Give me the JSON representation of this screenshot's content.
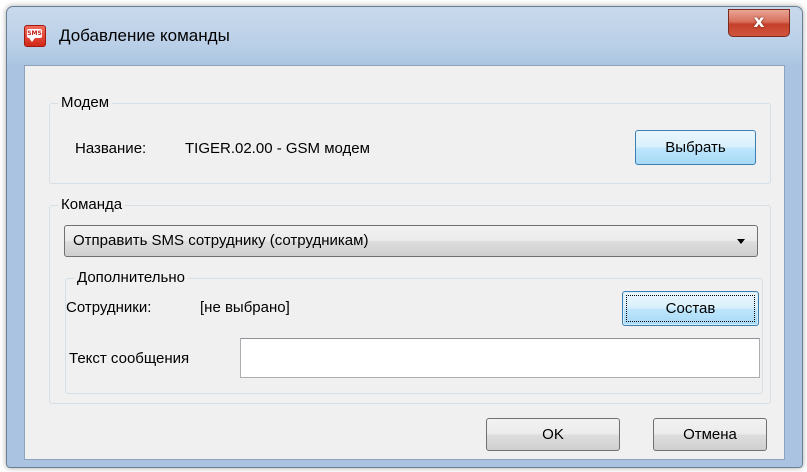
{
  "window": {
    "title": "Добавление команды",
    "app_icon": "sms-icon",
    "close_label": "x"
  },
  "modem_group": {
    "legend": "Модем",
    "name_label": "Название:",
    "name_value": "TIGER.02.00 - GSM модем",
    "select_button": "Выбрать"
  },
  "command_group": {
    "legend": "Команда",
    "selected_command": "Отправить SMS сотруднику (сотрудникам)",
    "dropdown_icon": "chevron-down-icon"
  },
  "additional_group": {
    "legend": "Дополнительно",
    "employees_label": "Сотрудники:",
    "employees_value": "[не выбрано]",
    "compose_button": "Состав",
    "message_label": "Текст сообщения",
    "message_value": ""
  },
  "footer": {
    "ok_button": "OK",
    "cancel_button": "Отмена"
  },
  "colors": {
    "title_bar": "#b9cfe7",
    "close_button": "#c4402a",
    "client_bg": "#f0f0f0",
    "default_button_border": "#3c7fb1"
  }
}
